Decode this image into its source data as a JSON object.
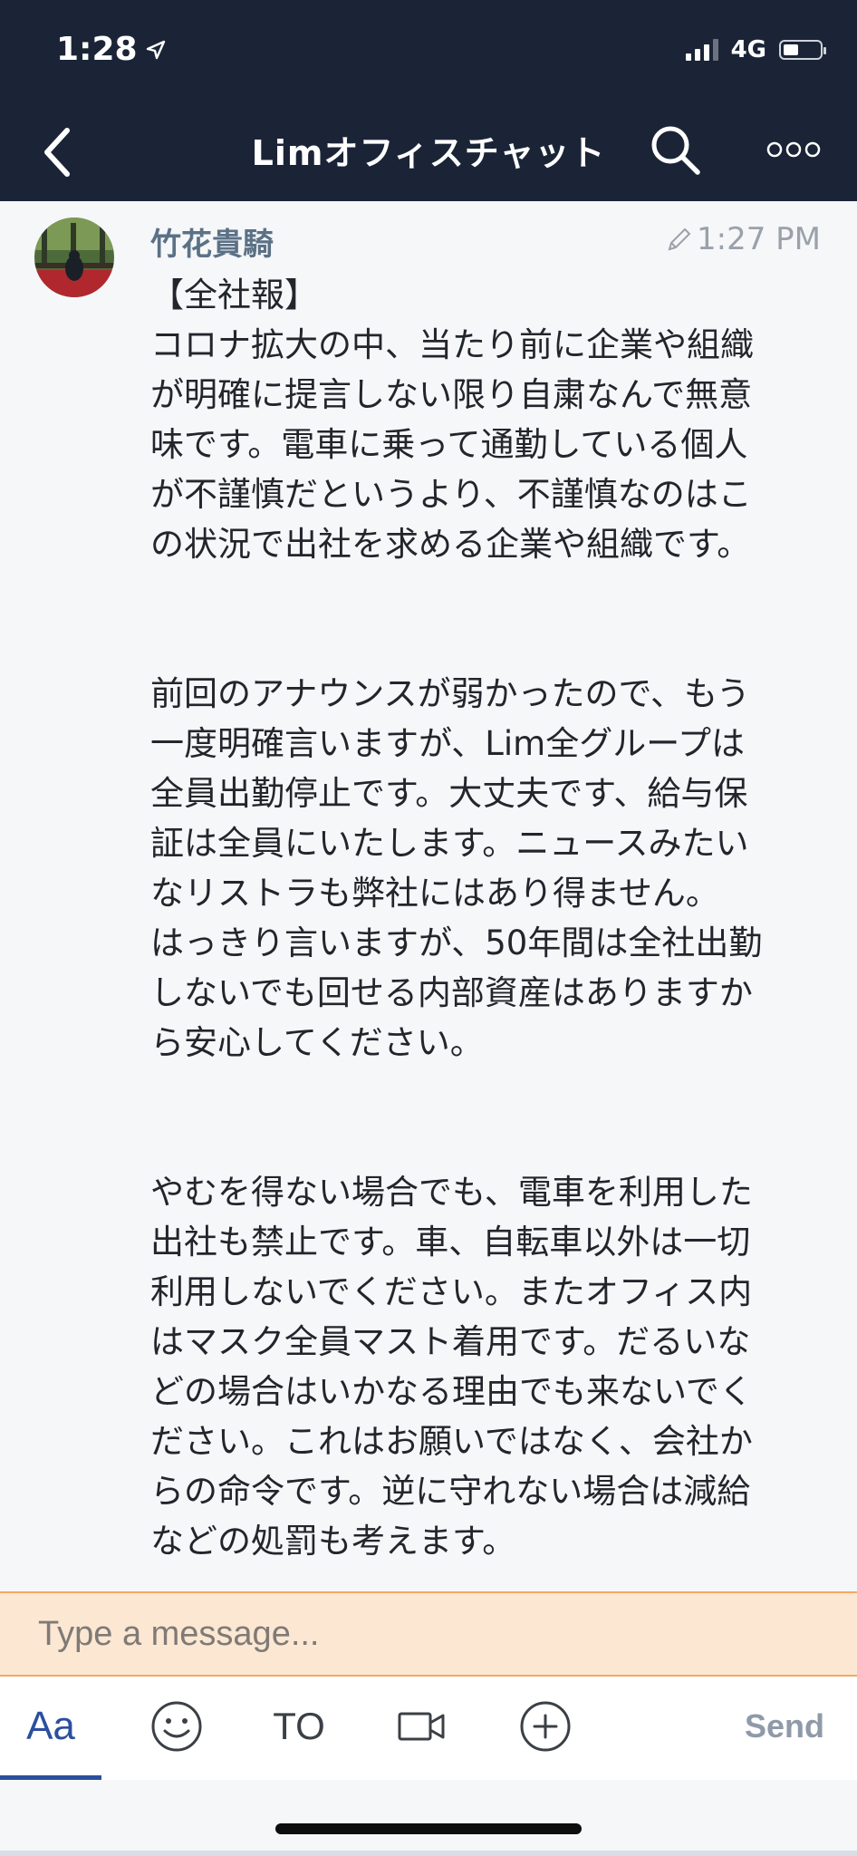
{
  "status_bar": {
    "time": "1:28",
    "network": "4G"
  },
  "header": {
    "title": "Limオフィスチャット"
  },
  "message": {
    "sender": "竹花貴騎",
    "time": "1:27 PM",
    "text": "【全社報】\nコロナ拡大の中、当たり前に企業や組織\nが明確に提言しない限り自粛なんで無意\n味です。電車に乗って通勤している個人\nが不謹慎だというより、不謹慎なのはこ\nの状況で出社を求める企業や組織です。\n\n\n前回のアナウンスが弱かったので、もう\n一度明確言いますが、Lim全グループは\n全員出勤停止です。大丈夫です、給与保\n証は全員にいたします。ニュースみたい\nなリストラも弊社にはあり得ません。\nはっきり言いますが、50年間は全社出勤\nしないでも回せる内部資産はありますか\nら安心してください。\n\n\nやむを得ない場合でも、電車を利用した\n出社も禁止です。車、自転車以外は一切\n利用しないでください。またオフィス内\nはマスク全員マスト着用です。だるいな\nどの場合はいかなる理由でも来ないでく\nださい。これはお願いではなく、会社か\nらの命令です。逆に守れない場合は減給\nなどの処罰も考えます。"
  },
  "input": {
    "placeholder": "Type a message..."
  },
  "toolbar": {
    "format_label": "Aa",
    "to_label": "TO",
    "send_label": "Send"
  },
  "colors": {
    "header_bg": "#1b2437",
    "accent": "#2b4f9e",
    "input_bg": "#fce7d2",
    "input_border": "#f0a964",
    "sender": "#5b7186"
  },
  "icons": [
    "location-arrow-icon",
    "signal-icon",
    "battery-icon",
    "back-chevron-icon",
    "search-icon",
    "more-icon",
    "edit-pencil-icon",
    "smiley-icon",
    "video-icon",
    "plus-circle-icon"
  ]
}
